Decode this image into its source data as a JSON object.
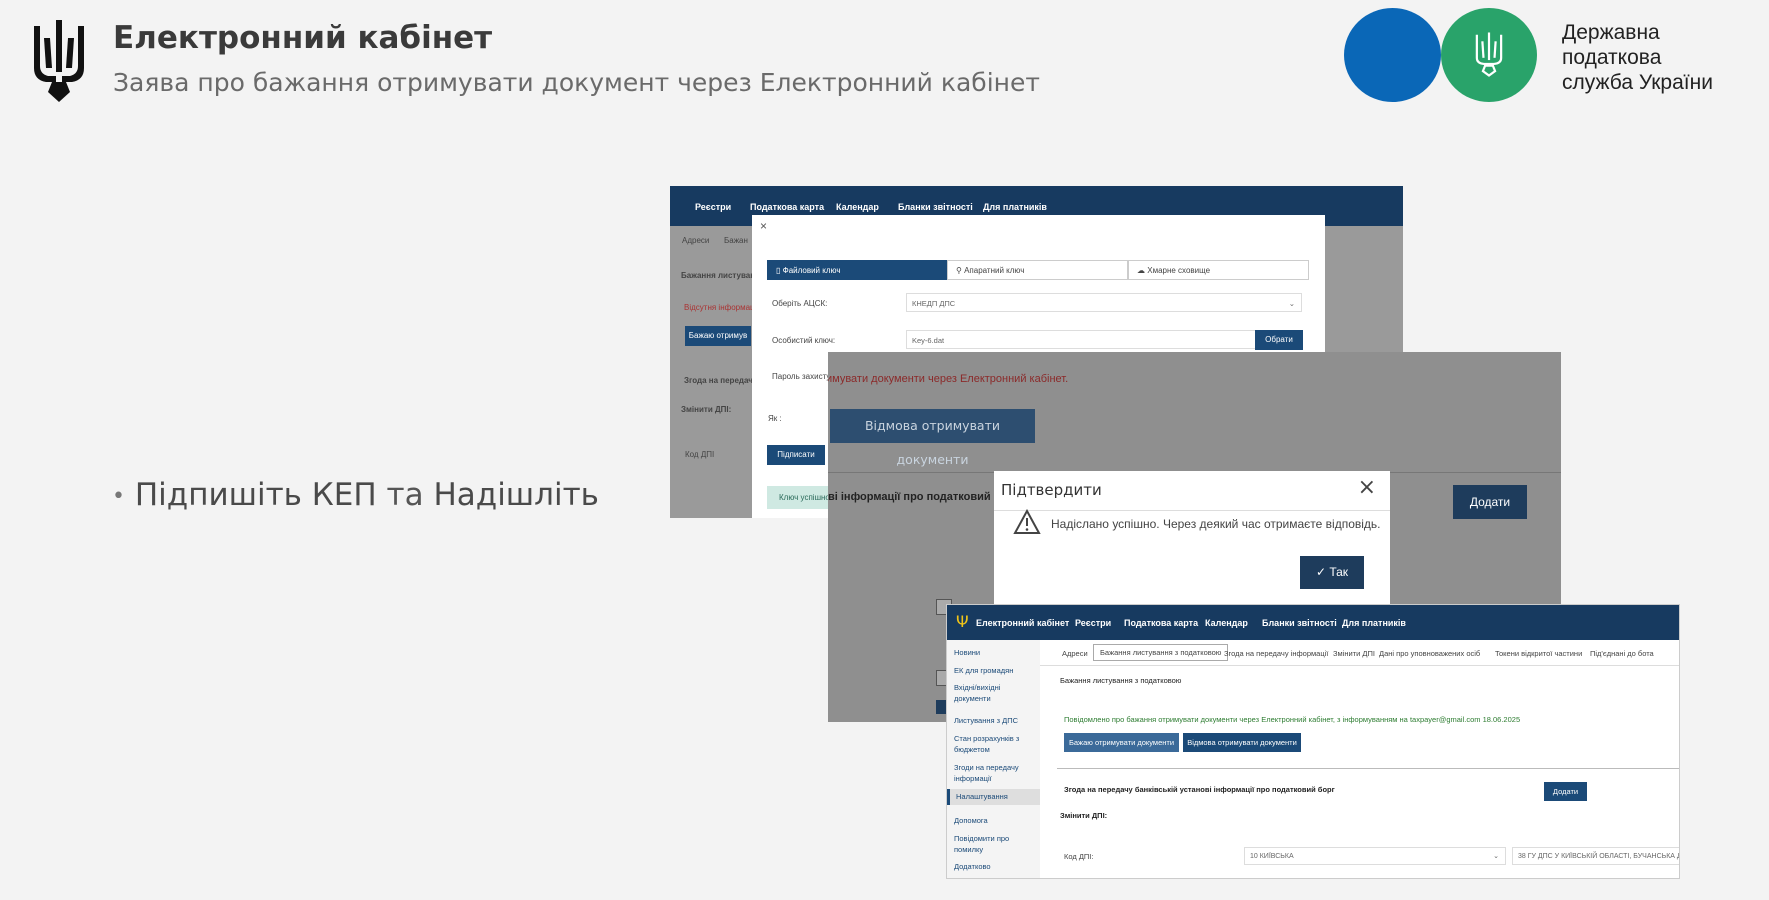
{
  "header": {
    "title": "Електронний кабінет",
    "subtitle": "Заява про бажання отримувати документ через Електронний кабінет",
    "brand_lines": [
      "Державна",
      "податкова",
      "служба України"
    ]
  },
  "bullet": {
    "part1": "Підпишіть КЕП",
    "conj": " та ",
    "part2": "Надішліть"
  },
  "colors": {
    "blue_circle": "#0a67b7",
    "green_circle": "#29a36a",
    "nav": "#173a60",
    "button": "#1b4a78"
  },
  "shot1": {
    "nav": [
      "Реєстри",
      "Податкова карта",
      "Календар",
      "Бланки звітності",
      "Для платників"
    ],
    "bg_items": [
      "Адреси",
      "Бажан",
      "Бажання листування",
      "Відсутня інформац",
      "Бажаю отримув",
      "Згода на передачу І",
      "Змінити ДПІ:",
      "Код ДПІ"
    ],
    "close": "×",
    "tabs": [
      "Файловий ключ",
      "Апаратний ключ",
      "Хмарне сховище"
    ],
    "acsk_label": "Оберіть АЦСК:",
    "acsk_value": "КНЕДП ДПС",
    "key_label": "Особистий ключ:",
    "key_value": "Key-6.dat",
    "choose_btn": "Обрати",
    "password_label": "Пароль захисту",
    "ya_label": "Як :",
    "sign_btn": "Підписати",
    "success": "Ключ успішно"
  },
  "shot2": {
    "text": "имувати документи через Електронний кабінет.",
    "refuse_btn": "Відмова отримувати документи",
    "bank_text": "ві інформації про податковий б",
    "add_btn": "Додати"
  },
  "dialog": {
    "title": "Підтвердити",
    "close": "×",
    "message": "Надіслано успішно. Через деякий час отримаєте відповідь.",
    "ok": "Так"
  },
  "shot3": {
    "app_name": "Електронний кабінет",
    "nav": [
      "Реєстри",
      "Податкова карта",
      "Календар",
      "Бланки звітності",
      "Для платників"
    ],
    "sidebar": [
      "Новини",
      "ЕК для громадян",
      "Вхідні/вихідні документи",
      "Листування з ДПС",
      "Стан розрахунків з бюджетом",
      "Згоди на передачу інформації",
      "Налаштування",
      "Допомога",
      "Повідомити про помилку",
      "Додатково"
    ],
    "tabs": [
      "Адреси",
      "Бажання листування з податковою",
      "Згода на передачу інформації",
      "Змінити ДПІ",
      "Дані про уповноважених осіб",
      "Токени відкритої частини",
      "Під'єднані до бота"
    ],
    "section_title": "Бажання листування з податковою",
    "notice": "Повідомлено про бажання отримувати документи через Електронний кабінет, з інформуванням на taxpayer@gmail.com 18.06.2025",
    "btn_want": "Бажаю отримувати документи",
    "btn_refuse": "Відмова отримувати документи",
    "bank_text": "Згода на передачу банківській установі інформації про податковий борг",
    "add_btn": "Додати",
    "change_dpi": "Змінити ДПІ:",
    "code_label": "Код ДПІ:",
    "code_value": "10 КИЇВСЬКА",
    "dpi_value": "38 ГУ ДПС У КИЇВСЬКІЙ ОБЛАСТІ, БУЧАНСЬКА Д"
  }
}
